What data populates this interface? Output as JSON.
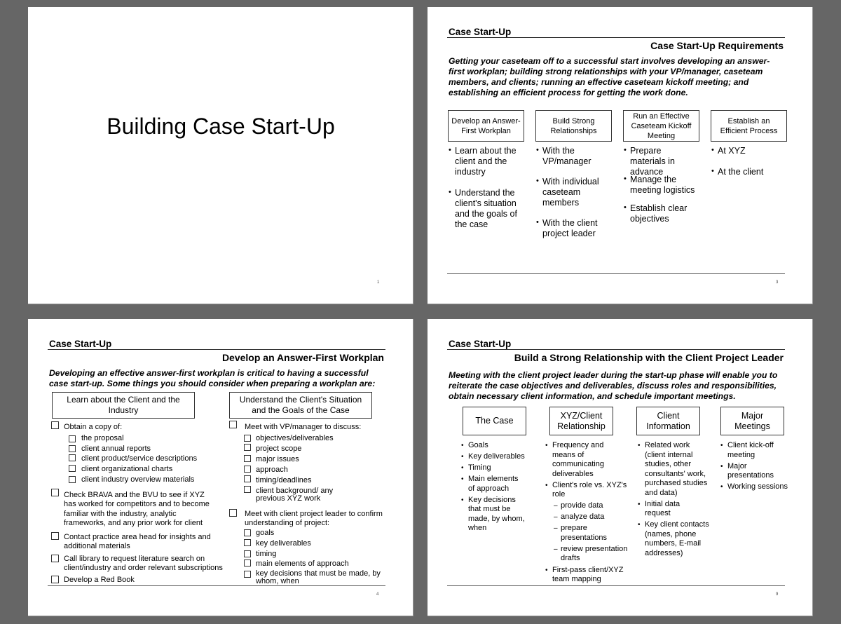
{
  "slide1": {
    "title": "Building Case Start-Up",
    "page": "1"
  },
  "slide3": {
    "section": "Case Start-Up",
    "title": "Case Start-Up Requirements",
    "intro_lines": [
      "Getting your caseteam off to a successful start involves developing an answer-",
      "first workplan; building strong relationships with your VP/manager, caseteam",
      "members, and clients; running an effective caseteam kickoff meeting; and",
      "establishing an efficient process for getting the work done."
    ],
    "columns": [
      {
        "header": "Develop an Answer-First Workplan",
        "bullets": [
          "Learn about the client and the industry",
          "Understand the client's situation and the goals of the case"
        ]
      },
      {
        "header": "Build Strong Relationships",
        "bullets": [
          "With the VP/manager",
          "With individual caseteam members",
          "With the client project leader"
        ]
      },
      {
        "header": "Run an Effective Caseteam Kickoff Meeting",
        "bullets": [
          "Prepare materials in advance",
          "Manage the meeting logistics",
          "Establish clear objectives"
        ]
      },
      {
        "header": "Establish an Efficient Process",
        "bullets": [
          "At XYZ",
          "At the client"
        ]
      }
    ],
    "page": "3"
  },
  "slide4": {
    "section": "Case Start-Up",
    "title": "Develop an Answer-First Workplan",
    "intro_lines": [
      "Developing an effective answer-first workplan is critical to having a successful",
      "case start-up.  Some things you should consider when preparing a workplan are:"
    ],
    "left": {
      "header": "Learn about the Client and  the Industry",
      "items": [
        {
          "text": "Obtain a copy of:",
          "sub": [
            "the proposal",
            "client annual reports",
            "client product/service descriptions",
            "client organizational charts",
            "client industry overview materials"
          ]
        },
        {
          "text": "Check BRAVA and the BVU to see if XYZ has worked for competitors and to become familiar with the industry, analytic frameworks, and any prior work for client"
        },
        {
          "text": "Contact practice area head for insights and additional materials"
        },
        {
          "text": "Call library to request literature search on client/industry and order relevant subscriptions"
        },
        {
          "text": "Develop a Red Book"
        }
      ]
    },
    "right": {
      "header": "Understand the Client's Situation and the Goals of the Case",
      "items": [
        {
          "text": "Meet with VP/manager to discuss:",
          "sub": [
            "objectives/deliverables",
            "project scope",
            "major issues",
            "approach",
            "timing/deadlines",
            "client background/ any previous XYZ work"
          ]
        },
        {
          "text": "Meet with client project leader to confirm understanding of project:",
          "sub": [
            "goals",
            "key deliverables",
            "timing",
            "main elements of approach",
            "key decisions that must be made, by whom, when"
          ]
        }
      ]
    },
    "page": "4"
  },
  "slide9": {
    "section": "Case Start-Up",
    "title": "Build a Strong Relationship with the Client Project Leader",
    "intro_lines": [
      "Meeting with the client project leader during the start-up phase will enable you to",
      "reiterate the case objectives and deliverables, discuss roles and responsibilities,",
      "obtain necessary client information, and schedule important meetings."
    ],
    "columns": [
      {
        "header": "The Case",
        "bullets": [
          "Goals",
          "Key deliverables",
          "Timing",
          "Main elements of approach",
          "Key decisions that must be made, by whom, when"
        ]
      },
      {
        "header": "XYZ/Client Relationship",
        "bullets": [
          "Frequency and means of communicating deliverables",
          "Client's role vs. XYZ's role"
        ],
        "sub": [
          "provide data",
          "analyze data",
          "prepare presentations",
          "review presentation drafts"
        ],
        "bullets_after": [
          "First-pass client/XYZ team mapping"
        ]
      },
      {
        "header": "Client Information",
        "bullets": [
          "Related work (client internal studies, other consultants' work, purchased studies and data)",
          "Initial data request",
          "Key client contacts (names, phone numbers, E-mail addresses)"
        ]
      },
      {
        "header": "Major Meetings",
        "bullets": [
          "Client kick-off meeting",
          "Major presentations",
          "Working sessions"
        ]
      }
    ],
    "page": "9"
  }
}
